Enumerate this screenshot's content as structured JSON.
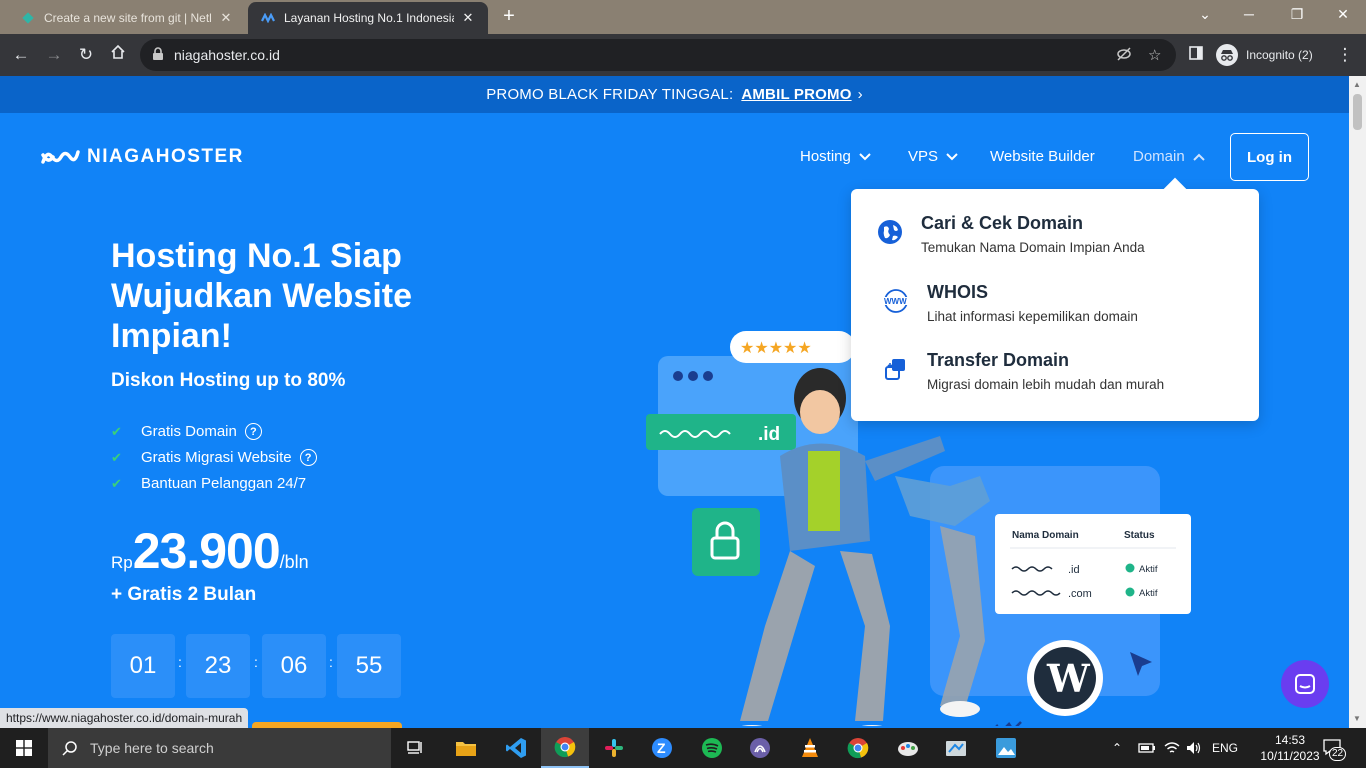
{
  "browser": {
    "tabs": [
      {
        "title": "Create a new site from git | Netlify",
        "close": "✕"
      },
      {
        "title": "Layanan Hosting No.1 Indonesia",
        "close": "✕"
      }
    ],
    "new_tab": "+",
    "url": "niagahoster.co.id",
    "incognito_label": "Incognito (2)"
  },
  "site": {
    "promo_text": "PROMO BLACK FRIDAY TINGGAL:",
    "promo_cta": "AMBIL PROMO",
    "promo_arrow": "›",
    "logo_text": "NIAGAHOSTER",
    "nav": {
      "hosting": "Hosting",
      "vps": "VPS",
      "website_builder": "Website Builder",
      "domain": "Domain",
      "login": "Log in"
    },
    "hero": {
      "title": "Hosting No.1 Siap Wujudkan Website Impian!",
      "subtitle": "Diskon Hosting up to 80%",
      "features": [
        "Gratis Domain",
        "Gratis Migrasi Website",
        "Bantuan Pelanggan 24/7"
      ],
      "price_prefix": "Rp",
      "price": "23.900",
      "price_suffix": "/bln",
      "bonus": "+ Gratis 2 Bulan",
      "countdown": [
        "01",
        "23",
        "06",
        "55"
      ]
    },
    "domain_menu": [
      {
        "title": "Cari & Cek Domain",
        "desc": "Temukan Nama Domain Impian Anda",
        "icon": "globe-icon"
      },
      {
        "title": "WHOIS",
        "desc": "Lihat informasi kepemilikan domain",
        "icon": "www-icon"
      },
      {
        "title": "Transfer Domain",
        "desc": "Migrasi domain lebih mudah dan murah",
        "icon": "transfer-icon"
      }
    ],
    "illustration": {
      "domain_tag": ".id",
      "table_headers": [
        "Nama Domain",
        "Status"
      ],
      "rows": [
        {
          "domain": ".id",
          "status": "Aktif"
        },
        {
          "domain": ".com",
          "status": "Aktif"
        }
      ]
    },
    "status_url": "https://www.niagahoster.co.id/domain-murah"
  },
  "taskbar": {
    "search_placeholder": "Type here to search",
    "lang": "ENG",
    "time": "14:53",
    "date": "10/11/2023",
    "notifications": "22"
  },
  "colors": {
    "brand_blue": "#1183f7",
    "promo_blue": "#0a64c9",
    "check_green": "#3ad07a",
    "cta_orange": "#f5a623"
  }
}
